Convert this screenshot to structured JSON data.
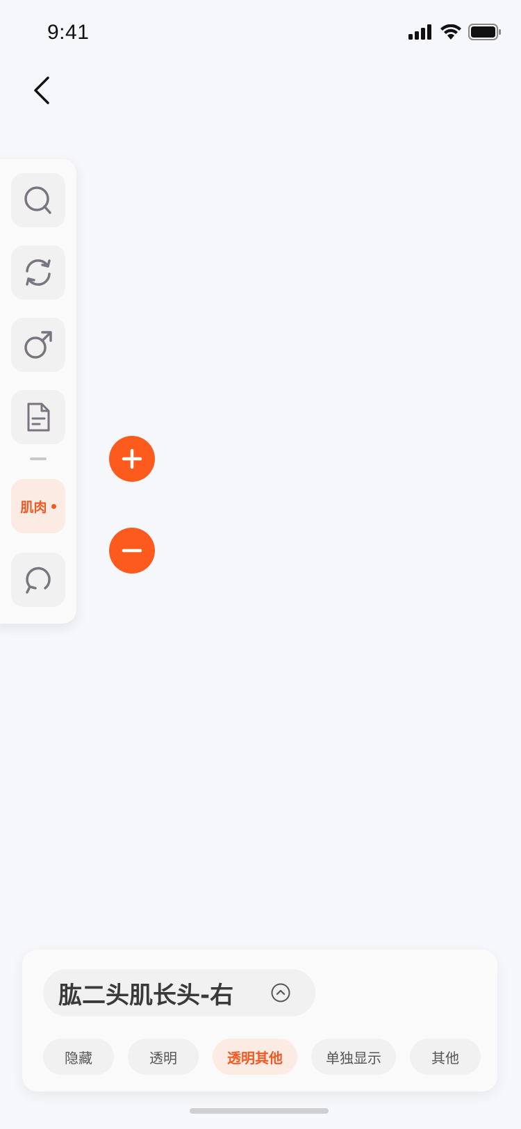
{
  "status_bar": {
    "time": "9:41"
  },
  "toolbar": {
    "items": [
      {
        "name": "search-icon"
      },
      {
        "name": "refresh-icon"
      },
      {
        "name": "male-icon"
      },
      {
        "name": "document-icon"
      },
      {
        "name": "muscle",
        "label": "肌肉"
      },
      {
        "name": "reset-icon"
      }
    ]
  },
  "zoom": {
    "in_icon": "plus-icon",
    "out_icon": "minus-icon"
  },
  "selection": {
    "muscle_name": "肱二头肌长头-右",
    "actions": [
      "隐藏",
      "透明",
      "透明其他",
      "单独显示",
      "其他"
    ],
    "active_action": "透明其他"
  },
  "colors": {
    "accent": "#fd5a1e",
    "accent_soft": "#fcebe2",
    "icon": "#7a7480"
  }
}
